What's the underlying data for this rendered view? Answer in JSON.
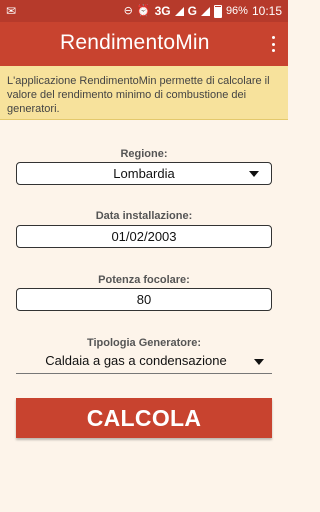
{
  "status_bar": {
    "network": "3G",
    "network_sup": "3G",
    "network2": "G",
    "battery": "96%",
    "time": "10:15"
  },
  "app_bar": {
    "title": "RendimentoMin"
  },
  "banner": {
    "text": "L'applicazione RendimentoMin permette di calcolare il valore del rendimento minimo di combustione dei generatori."
  },
  "form": {
    "regione": {
      "label": "Regione:",
      "value": "Lombardia"
    },
    "data": {
      "label": "Data installazione:",
      "value": "01/02/2003"
    },
    "potenza": {
      "label": "Potenza focolare:",
      "value": "80"
    },
    "tipologia": {
      "label": "Tipologia Generatore:",
      "value": "Caldaia a gas a condensazione"
    }
  },
  "button": {
    "label": "CALCOLA"
  },
  "colors": {
    "accent": "#c8432f",
    "status_bar": "#b63a2b",
    "banner": "#f7e29c",
    "background": "#fdf4ea"
  }
}
